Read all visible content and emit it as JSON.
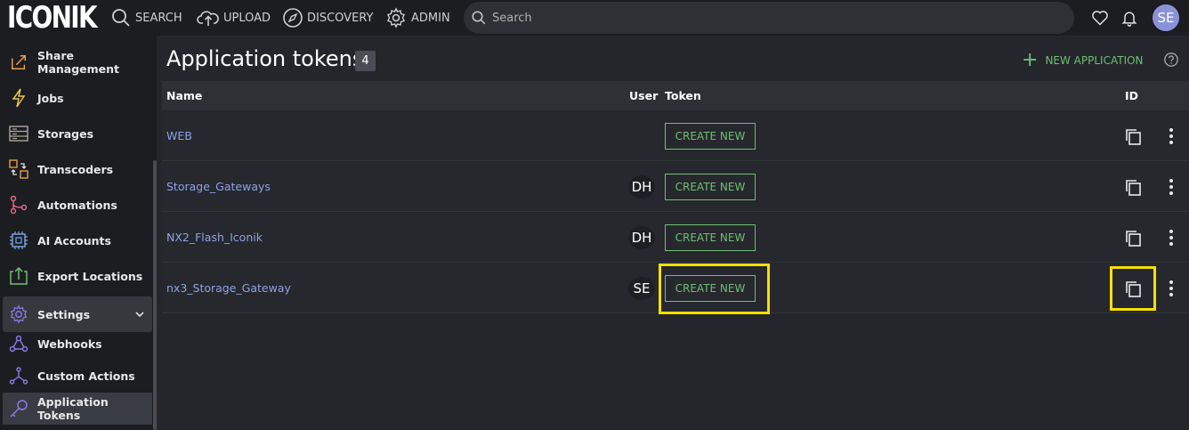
{
  "app": {
    "logo": "ICONIK"
  },
  "topnav": {
    "items": [
      {
        "label": "SEARCH",
        "icon": "search-icon"
      },
      {
        "label": "UPLOAD",
        "icon": "cloud-upload-icon"
      },
      {
        "label": "DISCOVERY",
        "icon": "compass-icon"
      },
      {
        "label": "ADMIN",
        "icon": "gear-icon"
      }
    ],
    "search_placeholder": "Search",
    "avatar": "SE"
  },
  "sidebar": {
    "items": [
      {
        "label": "Share Management",
        "icon": "share-icon"
      },
      {
        "label": "Jobs",
        "icon": "lightning-icon"
      },
      {
        "label": "Storages",
        "icon": "storage-icon"
      },
      {
        "label": "Transcoders",
        "icon": "transcoder-icon"
      },
      {
        "label": "Automations",
        "icon": "automation-icon"
      },
      {
        "label": "AI Accounts",
        "icon": "chip-icon"
      },
      {
        "label": "Export Locations",
        "icon": "export-icon"
      }
    ],
    "settings": {
      "label": "Settings",
      "icon": "gear-icon"
    },
    "sub_items": [
      {
        "label": "Webhooks",
        "icon": "webhook-icon"
      },
      {
        "label": "Custom Actions",
        "icon": "custom-actions-icon"
      },
      {
        "label": "Application Tokens",
        "icon": "key-icon"
      }
    ]
  },
  "main": {
    "title": "Application tokens",
    "count": "4",
    "new_button": "NEW APPLICATION",
    "columns": {
      "name": "Name",
      "user": "User",
      "token": "Token",
      "id": "ID"
    },
    "rows": [
      {
        "name": "WEB",
        "user": "",
        "token_button": "CREATE NEW"
      },
      {
        "name": "Storage_Gateways",
        "user": "DH",
        "token_button": "CREATE NEW"
      },
      {
        "name": "NX2_Flash_Iconik",
        "user": "DH",
        "token_button": "CREATE NEW"
      },
      {
        "name": "nx3_Storage_Gateway",
        "user": "SE",
        "token_button": "CREATE NEW"
      }
    ]
  },
  "colors": {
    "accent_green": "#6fbf73",
    "link_blue": "#8ea2e8",
    "highlight": "#f5e000",
    "icon_purple": "#8b7be8",
    "icon_orange": "#e8a04a"
  }
}
